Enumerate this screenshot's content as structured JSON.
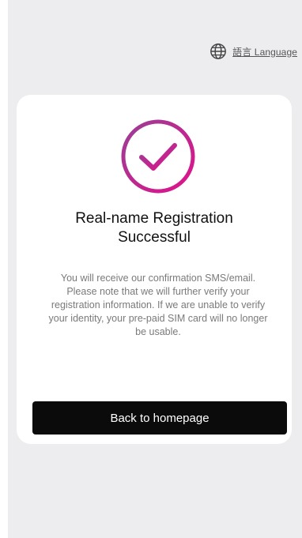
{
  "header": {
    "language_icon": "globe-icon",
    "language_label": "語言 Language"
  },
  "success": {
    "icon": "check-circle-icon",
    "icon_gradient": [
      "#a23b91",
      "#d6138a"
    ],
    "title_line1": "Real-name Registration",
    "title_line2": "Successful",
    "message_lines": [
      "You will receive our confirmation SMS/email.",
      "Please note that we will further verify your",
      "registration information. If we are unable to verify",
      "your identity, your pre-paid SIM card will no longer",
      "be usable."
    ]
  },
  "actions": {
    "back_label": "Back to homepage",
    "button_color": "#0b0b0b"
  },
  "colors": {
    "background": "#ededf0",
    "card": "#ffffff",
    "accent": "#d6138a"
  }
}
